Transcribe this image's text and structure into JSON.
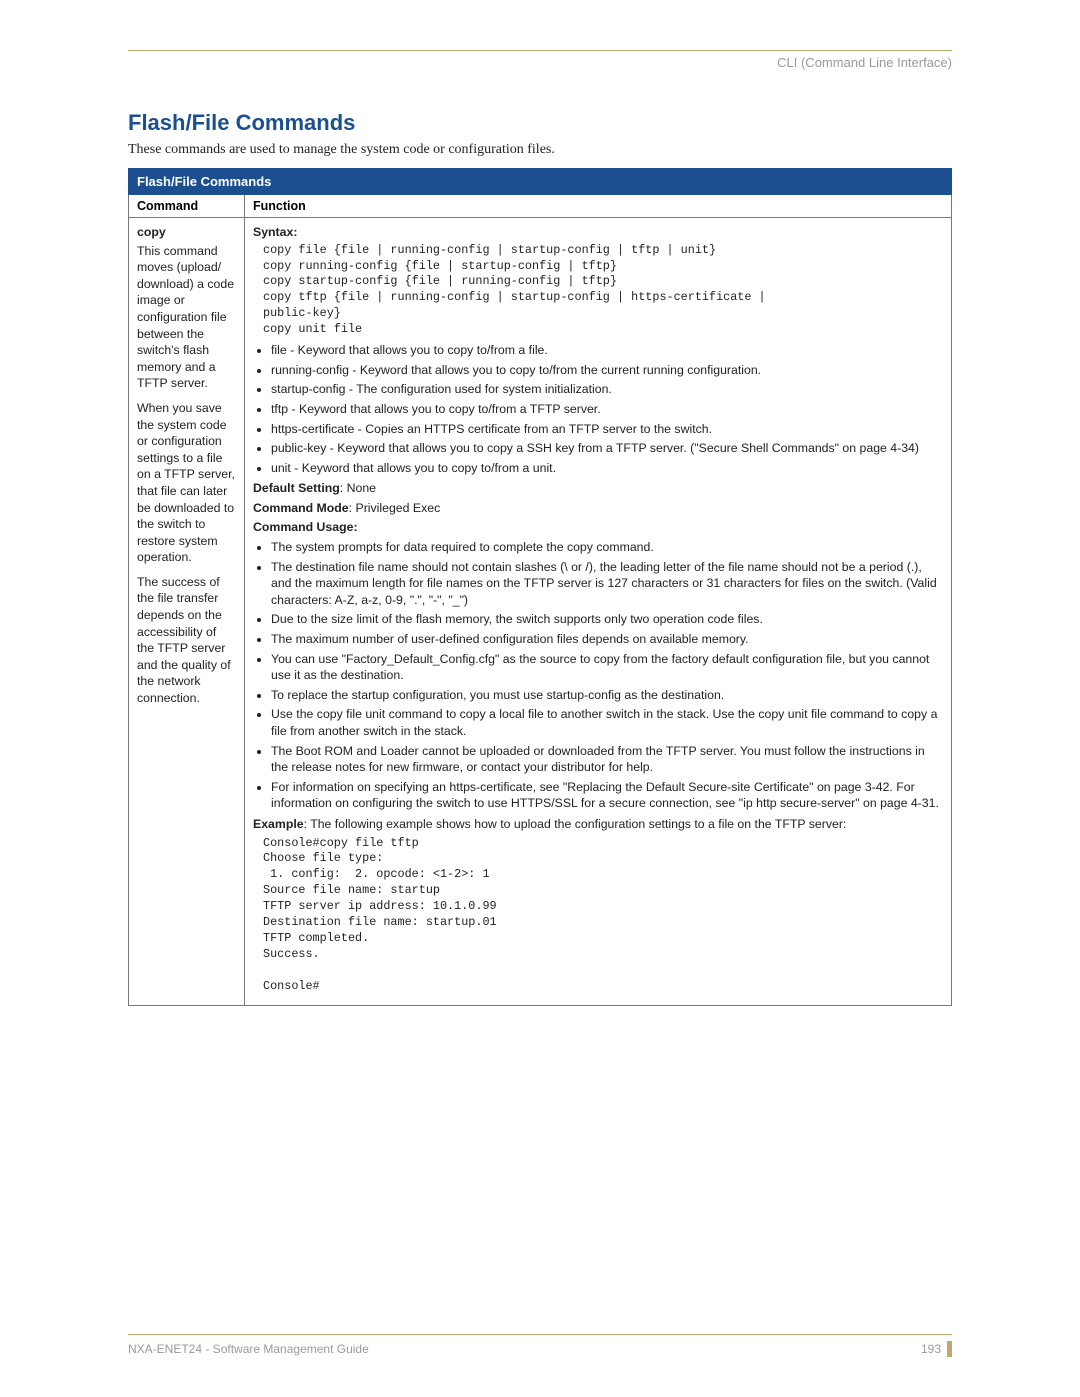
{
  "breadcrumb": "CLI (Command Line Interface)",
  "section_title": "Flash/File Commands",
  "intro": "These commands are used to manage the system code or configuration files.",
  "table_title": "Flash/File Commands",
  "col_command": "Command",
  "col_function": "Function",
  "command": {
    "name": "copy",
    "desc_p1": "This command moves (upload/ download) a code image or configuration file between the switch's flash memory and a TFTP server.",
    "desc_p2": "When you save the system code or configuration settings to a file on a TFTP server, that file can later be downloaded to the switch to restore system operation.",
    "desc_p3": "The success of the file transfer depends on the accessibility of the TFTP server and the quality of the network connection."
  },
  "func": {
    "syntax_label": "Syntax:",
    "syntax_block": "copy file {file | running-config | startup-config | tftp | unit}\ncopy running-config {file | startup-config | tftp}\ncopy startup-config {file | running-config | tftp}\ncopy tftp {file | running-config | startup-config | https-certificate |\npublic-key}\ncopy unit file",
    "keywords": [
      "file - Keyword that allows you to copy to/from a file.",
      "running-config - Keyword that allows you to copy to/from the current running configuration.",
      "startup-config - The configuration used for system initialization.",
      "tftp - Keyword that allows you to copy to/from a TFTP server.",
      "https-certificate - Copies an HTTPS certificate from an TFTP server to the switch.",
      "public-key - Keyword that allows you to copy a SSH key from a TFTP server. (\"Secure Shell Commands\" on page 4-34)",
      "unit - Keyword that allows you to copy to/from a unit."
    ],
    "default_label": "Default Setting",
    "default_value": ": None",
    "mode_label": "Command Mode",
    "mode_value": ": Privileged Exec",
    "usage_label": "Command Usage:",
    "usage": [
      "The system prompts for data required to complete the copy command.",
      "The destination file name should not contain slashes (\\ or /), the leading letter of the file name should not be a period (.), and the maximum length for file names on the TFTP server is 127 characters or 31 characters for files on the switch. (Valid characters: A-Z, a-z, 0-9, \".\", \"-\", \"_\")",
      "Due to the size limit of the flash memory, the switch supports only two operation code files.",
      "The maximum number of user-defined configuration files depends on available memory.",
      "You can use \"Factory_Default_Config.cfg\" as the source to copy from the factory default configuration file, but you cannot use it as the destination.",
      "To replace the startup configuration, you must use startup-config as the destination.",
      "Use the copy file unit command to copy a local file to another switch in the stack. Use the copy unit file command to copy a file from another switch in the stack.",
      "The Boot ROM and Loader cannot be uploaded or downloaded from the TFTP server. You must follow the instructions in the release notes for new firmware, or contact your distributor for help.",
      "For information on specifying an https-certificate, see \"Replacing the Default Secure-site Certificate\" on page 3-42. For information on configuring the switch to use HTTPS/SSL for a secure connection, see \"ip http secure-server\" on page 4-31."
    ],
    "example_label": "Example",
    "example_text": ": The following example shows how to upload the configuration settings to a file on the TFTP server:",
    "example_block": "Console#copy file tftp\nChoose file type:\n 1. config:  2. opcode: <1-2>: 1\nSource file name: startup\nTFTP server ip address: 10.1.0.99\nDestination file name: startup.01\nTFTP completed.\nSuccess.\n\nConsole#"
  },
  "footer_left": "NXA-ENET24 - Software Management Guide",
  "footer_page": "193"
}
